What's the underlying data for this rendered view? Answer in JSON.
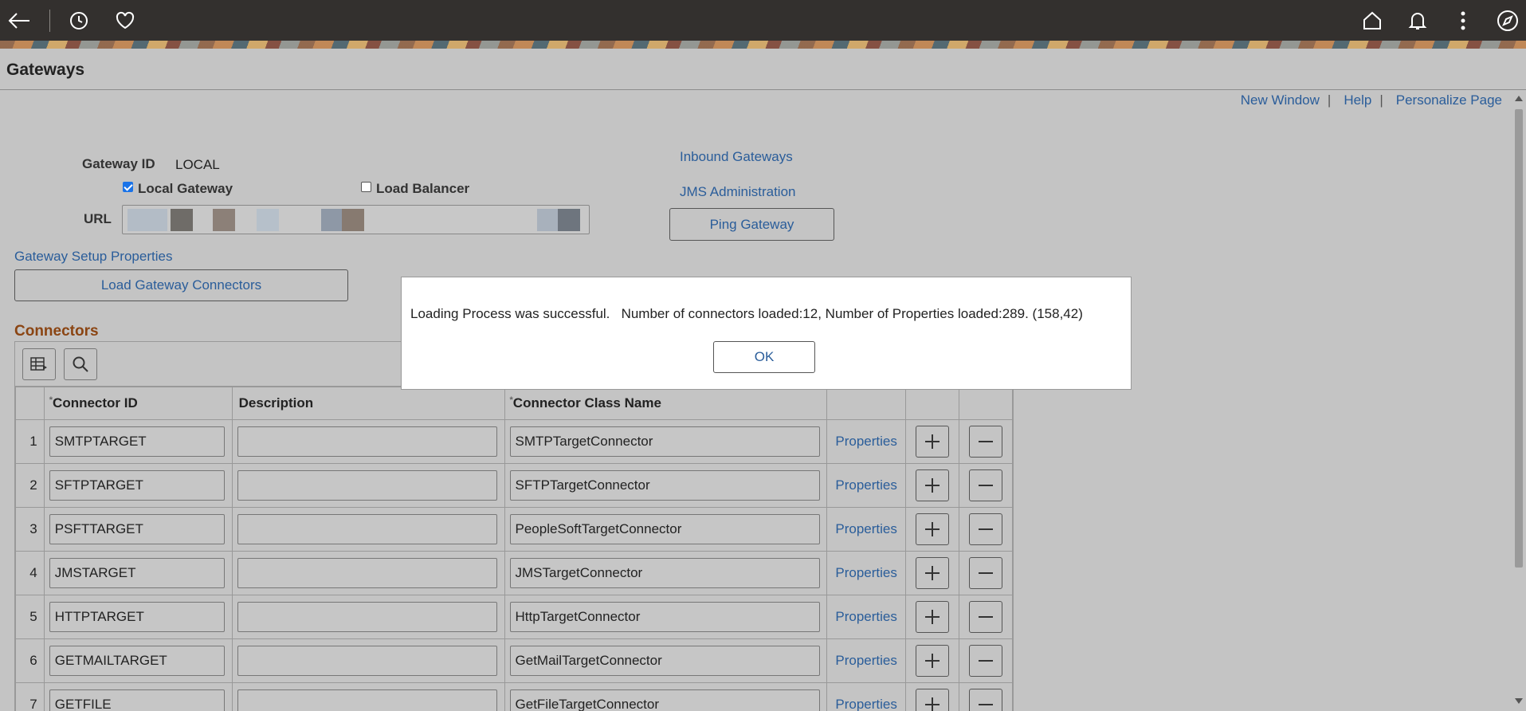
{
  "page_title": "Gateways",
  "toplinks": [
    "New Window",
    "Help",
    "Personalize Page"
  ],
  "topbar": {
    "icons": [
      "back-arrow-icon",
      "history-clock-icon",
      "favorites-heart-icon",
      "home-icon",
      "notifications-bell-icon",
      "more-vertical-icon",
      "compass-navigator-icon"
    ]
  },
  "gateway": {
    "id_label": "Gateway ID",
    "id_value": "LOCAL",
    "local_gateway_label": "Local Gateway",
    "local_gateway_checked": true,
    "load_balancer_label": "Load Balancer",
    "load_balancer_checked": false,
    "url_label": "URL"
  },
  "links": {
    "inbound_gateways": "Inbound Gateways",
    "jms_administration": "JMS Administration",
    "gateway_setup_properties": "Gateway Setup Properties"
  },
  "buttons": {
    "ping_gateway": "Ping Gateway",
    "load_gateway_connectors": "Load Gateway Connectors"
  },
  "connectors": {
    "section_title": "Connectors",
    "columns": {
      "required_marker": "*",
      "connector_id": "Connector ID",
      "description": "Description",
      "class_name": "Connector Class Name"
    },
    "rows": [
      {
        "num": "1",
        "id": "SMTPTARGET",
        "description": "",
        "class_name": "SMTPTargetConnector",
        "properties": "Properties"
      },
      {
        "num": "2",
        "id": "SFTPTARGET",
        "description": "",
        "class_name": "SFTPTargetConnector",
        "properties": "Properties"
      },
      {
        "num": "3",
        "id": "PSFTTARGET",
        "description": "",
        "class_name": "PeopleSoftTargetConnector",
        "properties": "Properties"
      },
      {
        "num": "4",
        "id": "JMSTARGET",
        "description": "",
        "class_name": "JMSTargetConnector",
        "properties": "Properties"
      },
      {
        "num": "5",
        "id": "HTTPTARGET",
        "description": "",
        "class_name": "HttpTargetConnector",
        "properties": "Properties"
      },
      {
        "num": "6",
        "id": "GETMAILTARGET",
        "description": "",
        "class_name": "GetMailTargetConnector",
        "properties": "Properties"
      },
      {
        "num": "7",
        "id": "GETFILE",
        "description": "",
        "class_name": "GetFileTargetConnector",
        "properties": "Properties"
      }
    ]
  },
  "modal": {
    "message": "Loading Process was successful.   Number of connectors loaded:12, Number of Properties loaded:289. (158,42)",
    "ok_label": "OK"
  }
}
